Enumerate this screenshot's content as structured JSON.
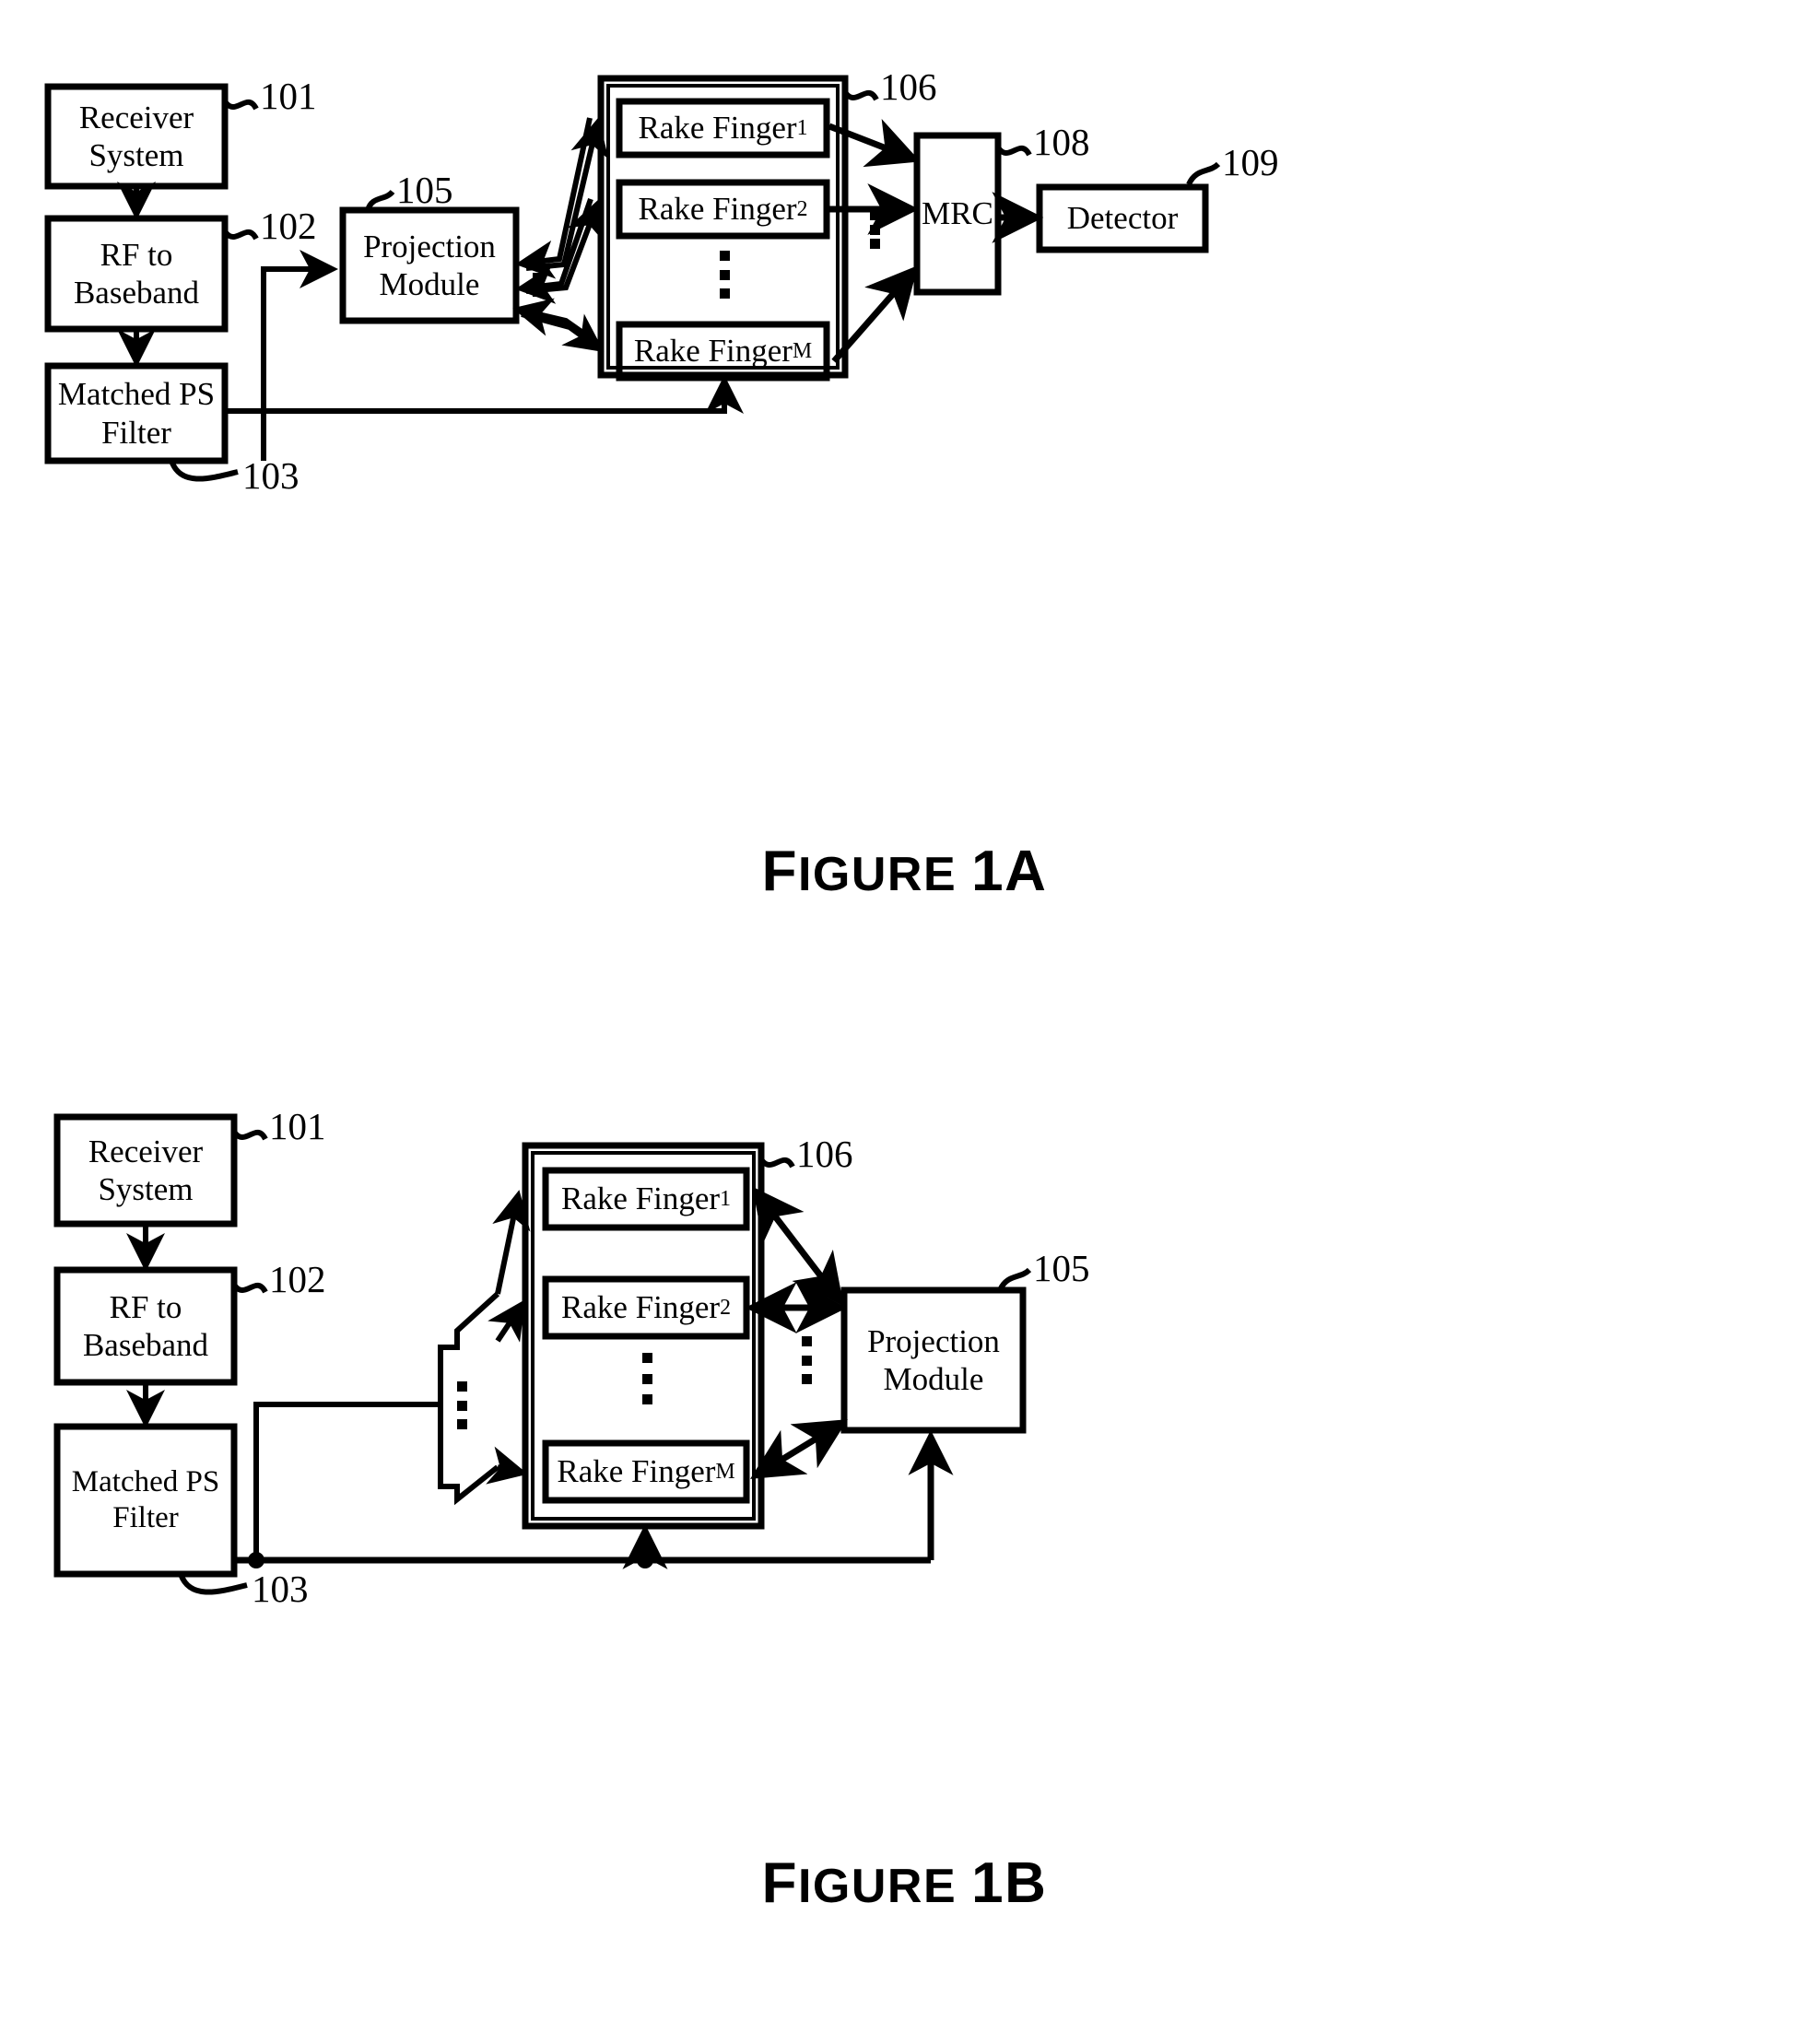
{
  "document": {
    "type": "patent-drawing-sheet",
    "figures": [
      {
        "id": "figure-1a",
        "caption": "Figure 1A",
        "caption_head": "F",
        "caption_rest": "IGURE",
        "caption_number": "1A",
        "blocks": [
          {
            "key": "receiver_system",
            "lines": [
              "Receiver",
              "System"
            ],
            "ref": "101"
          },
          {
            "key": "rf_to_baseband",
            "lines": [
              "RF to",
              "Baseband"
            ],
            "ref": "102"
          },
          {
            "key": "matched_ps_filter",
            "lines": [
              "Matched PS",
              "Filter"
            ],
            "ref": "103"
          },
          {
            "key": "projection_module",
            "lines": [
              "Projection",
              "Module"
            ],
            "ref": "105"
          },
          {
            "key": "rake_bank",
            "lines": [],
            "ref": "106"
          },
          {
            "key": "rake_finger_1",
            "lines": [
              "Rake Finger"
            ],
            "sub": "1"
          },
          {
            "key": "rake_finger_2",
            "lines": [
              "Rake Finger"
            ],
            "sub": "2"
          },
          {
            "key": "rake_finger_m",
            "lines": [
              "Rake Finger"
            ],
            "sub": "M"
          },
          {
            "key": "mrc",
            "lines": [
              "MRC"
            ],
            "ref": "108"
          },
          {
            "key": "detector",
            "lines": [
              "Detector"
            ],
            "ref": "109"
          }
        ],
        "ref_numbers": [
          "101",
          "102",
          "103",
          "105",
          "106",
          "108",
          "109"
        ]
      },
      {
        "id": "figure-1b",
        "caption": "Figure 1B",
        "caption_head": "F",
        "caption_rest": "IGURE",
        "caption_number": "1B",
        "blocks": [
          {
            "key": "receiver_system",
            "lines": [
              "Receiver",
              "System"
            ],
            "ref": "101"
          },
          {
            "key": "rf_to_baseband",
            "lines": [
              "RF to",
              "Baseband"
            ],
            "ref": "102"
          },
          {
            "key": "matched_ps_filter",
            "lines": [
              "Matched PS",
              "Filter"
            ],
            "ref": "103"
          },
          {
            "key": "rake_bank",
            "lines": [],
            "ref": "106"
          },
          {
            "key": "rake_finger_1",
            "lines": [
              "Rake Finger"
            ],
            "sub": "1"
          },
          {
            "key": "rake_finger_2",
            "lines": [
              "Rake Finger"
            ],
            "sub": "2"
          },
          {
            "key": "rake_finger_m",
            "lines": [
              "Rake Finger"
            ],
            "sub": "M"
          },
          {
            "key": "projection_module",
            "lines": [
              "Projection",
              "Module"
            ],
            "ref": "105"
          }
        ],
        "ref_numbers": [
          "101",
          "102",
          "103",
          "105",
          "106"
        ]
      }
    ]
  },
  "fig1a": {
    "caption_head": "F",
    "caption_rest": "IGURE",
    "caption_number": "1A",
    "receiver_system_l1": "Receiver",
    "receiver_system_l2": "System",
    "rf_to_baseband_l1": "RF to",
    "rf_to_baseband_l2": "Baseband",
    "matched_ps_filter_l1": "Matched PS",
    "matched_ps_filter_l2": "Filter",
    "projection_module_l1": "Projection",
    "projection_module_l2": "Module",
    "rake_finger_base": "Rake Finger",
    "rake_finger_1_sub": "1",
    "rake_finger_2_sub": "2",
    "rake_finger_m_sub": "M",
    "mrc": "MRC",
    "detector": "Detector",
    "ref_101": "101",
    "ref_102": "102",
    "ref_103": "103",
    "ref_105": "105",
    "ref_106": "106",
    "ref_108": "108",
    "ref_109": "109"
  },
  "fig1b": {
    "caption_head": "F",
    "caption_rest": "IGURE",
    "caption_number": "1B",
    "receiver_system_l1": "Receiver",
    "receiver_system_l2": "System",
    "rf_to_baseband_l1": "RF to",
    "rf_to_baseband_l2": "Baseband",
    "matched_ps_filter_l1": "Matched PS",
    "matched_ps_filter_l2": "Filter",
    "projection_module_l1": "Projection",
    "projection_module_l2": "Module",
    "rake_finger_base": "Rake Finger",
    "rake_finger_1_sub": "1",
    "rake_finger_2_sub": "2",
    "rake_finger_m_sub": "M",
    "ref_101": "101",
    "ref_102": "102",
    "ref_103": "103",
    "ref_105": "105",
    "ref_106": "106"
  },
  "colors": {
    "ink": "#000000",
    "paper": "#ffffff"
  }
}
